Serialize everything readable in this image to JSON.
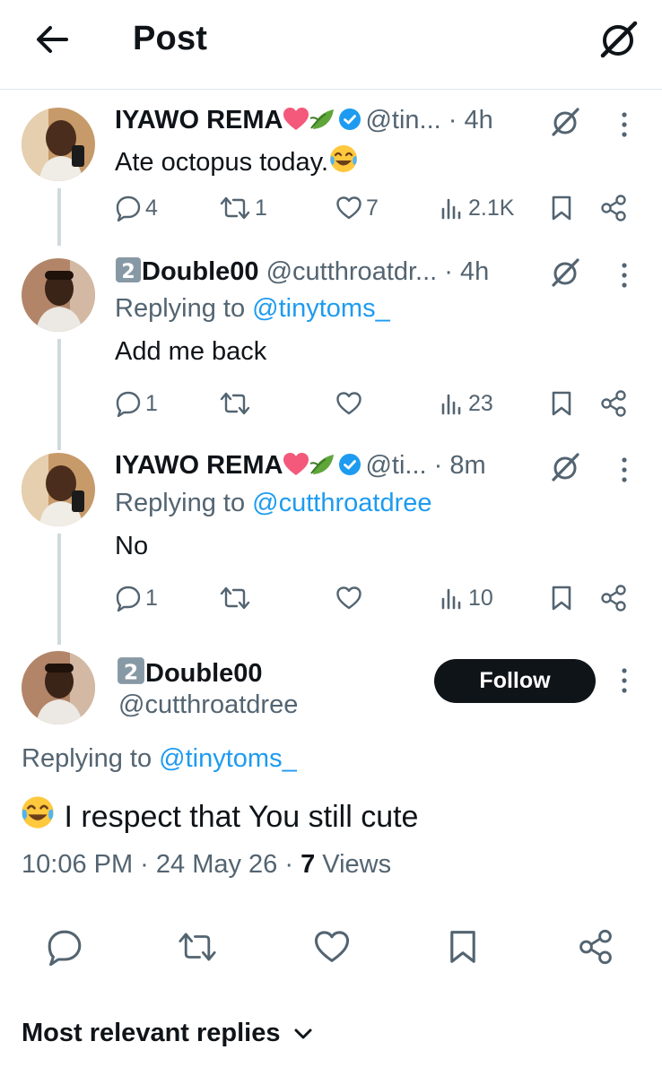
{
  "header": {
    "title": "Post"
  },
  "thread": [
    {
      "name": "IYAWO REMA",
      "handle": "@tin...",
      "time": "· 4h",
      "replying_prefix": "",
      "replying_to": "",
      "text": "Ate octopus today.",
      "text_emoji": "joy-emoji",
      "reply_count": "4",
      "repost_count": "1",
      "like_count": "7",
      "view_count": "2.1K",
      "verified": true
    },
    {
      "name": "Double00",
      "handle": "@cutthroatdr...",
      "time": "· 4h",
      "replying_prefix": "Replying to ",
      "replying_to": "@tinytoms_",
      "text": "Add me back",
      "reply_count": "1",
      "repost_count": "",
      "like_count": "",
      "view_count": "23",
      "verified": false
    },
    {
      "name": "IYAWO REMA",
      "handle": "@ti...",
      "time": "· 8m",
      "replying_prefix": "Replying to ",
      "replying_to": "@cutthroatdree",
      "text": "No",
      "reply_count": "1",
      "repost_count": "",
      "like_count": "",
      "view_count": "10",
      "verified": true
    }
  ],
  "main": {
    "name": "Double00",
    "handle": "@cutthroatdree",
    "follow_label": "Follow",
    "replying_prefix": "Replying to ",
    "replying_to": "@tinytoms_",
    "text": " I respect that You still cute",
    "timestamp": "10:06 PM · 24 May 26 · ",
    "views_count": "7",
    "views_label": " Views"
  },
  "sort": {
    "label": "Most relevant replies"
  },
  "colors": {
    "accent": "#1d9bf0",
    "text": "#0f1419",
    "secondary": "#536471",
    "thread_line": "#cfd9de",
    "heart_emoji": "#f4587a",
    "leaf_emoji": "#5fa53a"
  },
  "icons": [
    "back-arrow-icon",
    "grok-icon",
    "verified-badge-icon",
    "heart-emoji-icon",
    "leaf-emoji-icon",
    "joy-emoji-icon",
    "keycap-two-icon",
    "reply-icon",
    "repost-icon",
    "like-icon",
    "views-icon",
    "bookmark-icon",
    "share-icon",
    "more-vertical-icon",
    "chevron-down-icon"
  ]
}
